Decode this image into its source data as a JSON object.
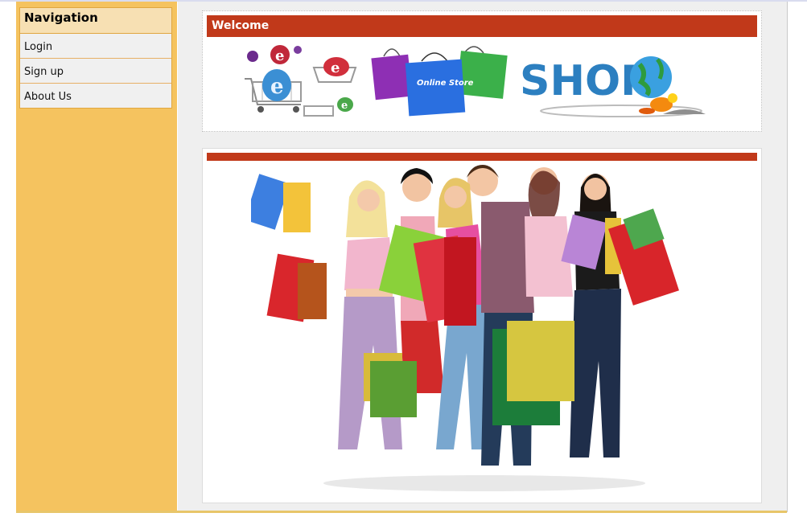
{
  "nav": {
    "heading": "Navigation",
    "items": [
      {
        "label": "Login"
      },
      {
        "label": "Sign up"
      },
      {
        "label": "About Us"
      }
    ]
  },
  "welcome_panel": {
    "title": "Welcome",
    "banner": {
      "bag_text": "Online Store",
      "shop_text": "SHOP"
    }
  },
  "shopping_panel": {
    "title": ""
  },
  "colors": {
    "sidebar": "#f5c35f",
    "nav_header": "#f7e0b3",
    "panel_bar": "#c1391a",
    "content_bg": "#efefef"
  }
}
